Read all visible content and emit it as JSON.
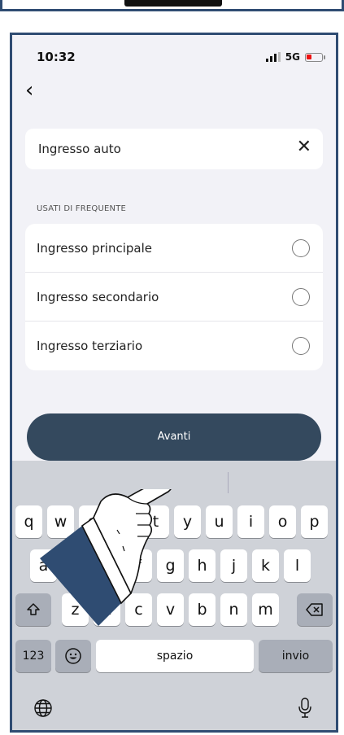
{
  "status_bar": {
    "time": "10:32",
    "network": "5G"
  },
  "search": {
    "value": "Ingresso auto"
  },
  "frequent": {
    "title": "USATI DI FREQUENTE",
    "items": [
      {
        "label": "Ingresso principale"
      },
      {
        "label": "Ingresso secondario"
      },
      {
        "label": "Ingresso terziario"
      }
    ]
  },
  "next_button": {
    "label": "Avanti"
  },
  "keyboard": {
    "row1": [
      "q",
      "w",
      "e",
      "r",
      "t",
      "y",
      "u",
      "i",
      "o",
      "p"
    ],
    "row2": [
      "a",
      "s",
      "d",
      "f",
      "g",
      "h",
      "j",
      "k",
      "l"
    ],
    "row3": [
      "z",
      "x",
      "c",
      "v",
      "b",
      "n",
      "m"
    ],
    "numbers_key": "123",
    "space_key": "spazio",
    "return_key": "invio"
  },
  "icons": [
    "back-chevron-icon",
    "close-icon",
    "shift-icon",
    "backspace-icon",
    "emoji-icon",
    "globe-icon",
    "microphone-icon",
    "hand-pointer-icon"
  ],
  "colors": {
    "primary_button": "#34495e",
    "frame": "#2f4c72",
    "battery_low": "#e11111"
  }
}
